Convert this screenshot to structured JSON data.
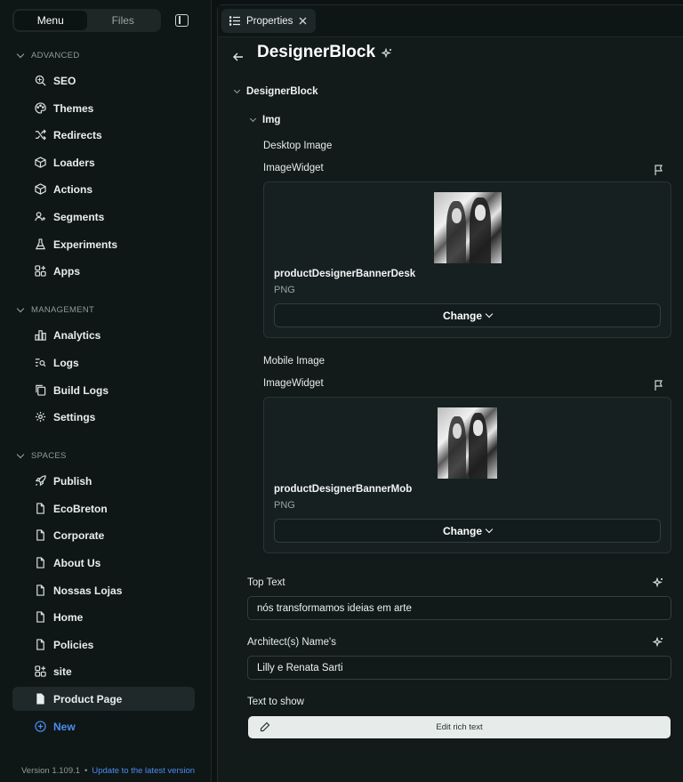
{
  "sidebar": {
    "tabs": {
      "menu": "Menu",
      "files": "Files"
    },
    "sections": {
      "advanced": "ADVANCED",
      "management": "MANAGEMENT",
      "spaces": "SPACES"
    },
    "advanced_items": [
      "SEO",
      "Themes",
      "Redirects",
      "Loaders",
      "Actions",
      "Segments",
      "Experiments",
      "Apps"
    ],
    "management_items": [
      "Analytics",
      "Logs",
      "Build Logs",
      "Settings"
    ],
    "spaces_items": [
      "Publish",
      "EcoBreton",
      "Corporate",
      "About Us",
      "Nossas Lojas",
      "Home",
      "Policies",
      "site",
      "Product Page"
    ],
    "new_label": "New",
    "version": "Version 1.109.1",
    "update_link": "Update to the latest version"
  },
  "main": {
    "tab_label": "Properties",
    "title": "DesignerBlock",
    "tree": {
      "root": "DesignerBlock",
      "child": "Img"
    },
    "desktop": {
      "section_label": "Desktop Image",
      "widget_label": "ImageWidget",
      "file_name": "productDesignerBannerDesk",
      "file_type": "PNG",
      "change_label": "Change"
    },
    "mobile": {
      "section_label": "Mobile Image",
      "widget_label": "ImageWidget",
      "file_name": "productDesignerBannerMob",
      "file_type": "PNG",
      "change_label": "Change"
    },
    "top_text": {
      "label": "Top Text",
      "value": "nós transformamos ideias em arte"
    },
    "architects": {
      "label": "Architect(s) Name's",
      "value": "Lilly e Renata Sarti"
    },
    "text_to_show": {
      "label": "Text to show",
      "button": "Edit rich text"
    }
  },
  "colors": {
    "accent_blue": "#4a8ef0",
    "background": "#0c1212",
    "active_item": "#1f2929"
  }
}
